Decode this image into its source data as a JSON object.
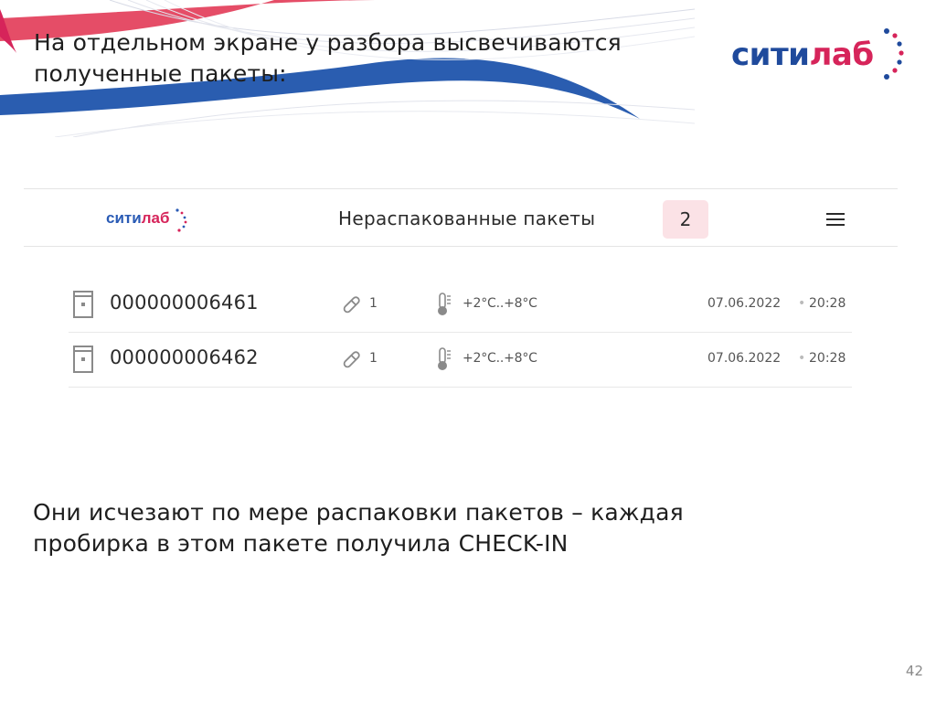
{
  "slide": {
    "title": "На отдельном экране у разбора высвечиваются\nполученные пакеты:",
    "body": "Они исчезают по мере распаковки пакетов – каждая\nпробирка в этом пакете получила CHECK-IN",
    "page_number": "42"
  },
  "brand": {
    "part1": "сити",
    "part2": "лаб",
    "color_blue": "#1f4a9c",
    "color_red": "#d6245a"
  },
  "app": {
    "logo_part1": "сити",
    "logo_part2": "лаб",
    "header_title": "Нераспакованные пакеты",
    "badge_count": "2",
    "menu_icon": "hamburger-icon",
    "packages": [
      {
        "id": "000000006461",
        "count": "1",
        "temperature": "+2°C..+8°C",
        "date": "07.06.2022",
        "separator": "•",
        "time": "20:28"
      },
      {
        "id": "000000006462",
        "count": "1",
        "temperature": "+2°C..+8°C",
        "date": "07.06.2022",
        "separator": "•",
        "time": "20:28"
      }
    ]
  }
}
